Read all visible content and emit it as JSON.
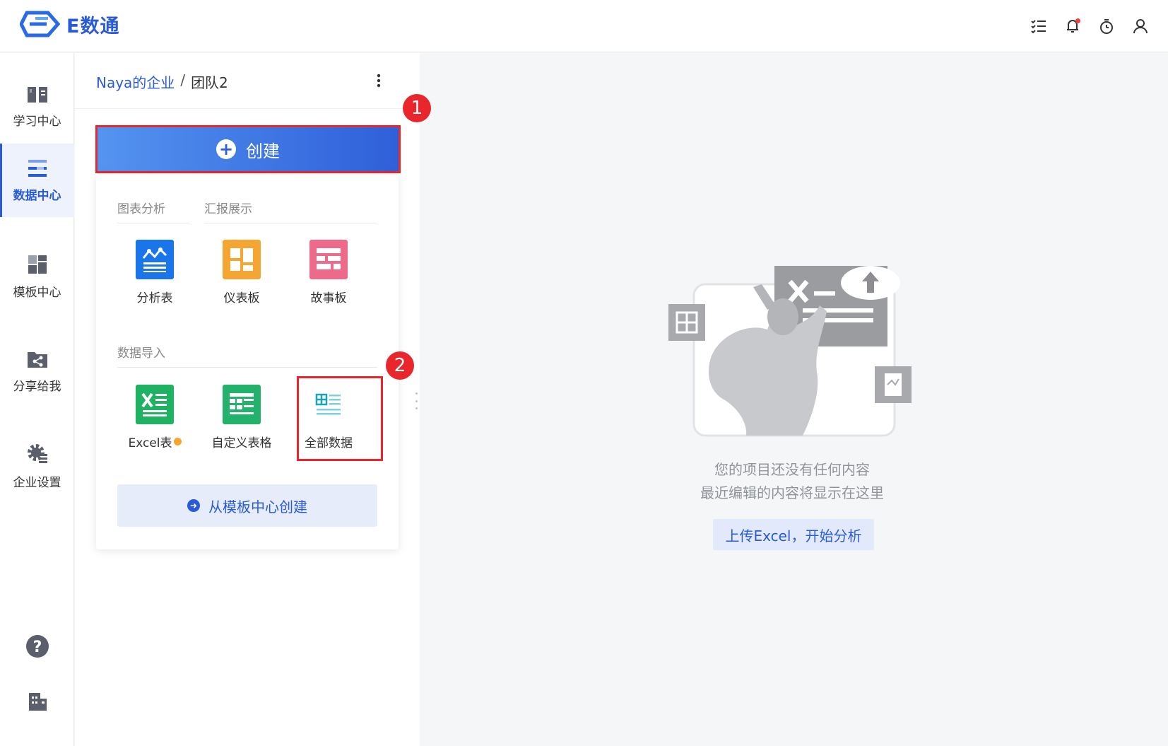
{
  "app": {
    "brand": "E数通"
  },
  "header": {
    "icons": [
      "task-list-icon",
      "bell-icon",
      "timer-icon",
      "user-icon"
    ]
  },
  "nav": {
    "items": [
      {
        "label": "学习中心",
        "icon": "book-icon",
        "active": false
      },
      {
        "label": "数据中心",
        "icon": "data-list-icon",
        "active": true
      },
      {
        "label": "模板中心",
        "icon": "template-grid-icon",
        "active": false
      },
      {
        "label": "分享给我",
        "icon": "share-folder-icon",
        "active": false
      },
      {
        "label": "企业设置",
        "icon": "gear-icon",
        "active": false
      }
    ],
    "bottom_icons": [
      "help-icon",
      "building-icon"
    ]
  },
  "panel": {
    "breadcrumb": {
      "org": "Naya的企业",
      "separator": "/",
      "team": "团队2"
    },
    "create_label": "创建",
    "badges": {
      "first": "1",
      "second": "2"
    },
    "tabs": {
      "chart": "图表分析",
      "report": "汇报展示"
    },
    "section_import": "数据导入",
    "analysis_tiles": [
      {
        "label": "分析表",
        "icon": "analysis-icon",
        "color": "#1a74ea"
      },
      {
        "label": "仪表板",
        "icon": "dashboard-icon",
        "color": "#f5a632"
      },
      {
        "label": "故事板",
        "icon": "storyboard-icon",
        "color": "#ee6a8a"
      }
    ],
    "import_tiles": [
      {
        "label": "Excel表",
        "icon": "excel-icon",
        "color": "#1fb262"
      },
      {
        "label": "自定义表格",
        "icon": "custom-table-icon",
        "color": "#23b26b"
      },
      {
        "label": "全部数据",
        "icon": "all-data-icon",
        "color": "#ffffff"
      }
    ],
    "template_button": "从模板中心创建"
  },
  "main": {
    "empty_line1": "您的项目还没有任何内容",
    "empty_line2": "最近编辑的内容将显示在这里",
    "upload_button": "上传Excel，开始分析"
  },
  "colors": {
    "accent": "#2a5bd7",
    "highlight": "#e8262c"
  }
}
